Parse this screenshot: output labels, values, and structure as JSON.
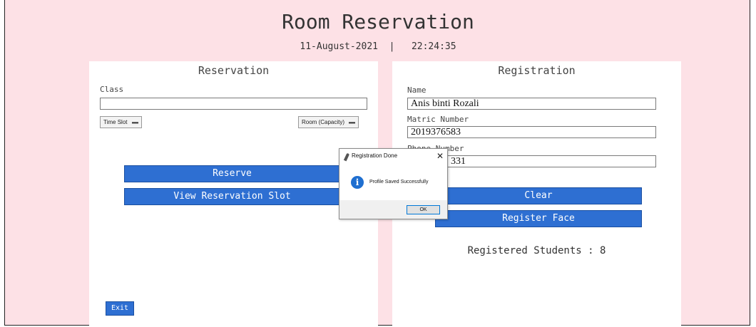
{
  "header": {
    "title": "Room Reservation",
    "date": "11-August-2021",
    "separator": "|",
    "time": "22:24:35"
  },
  "reservation": {
    "title": "Reservation",
    "class_label": "Class",
    "class_value": "",
    "time_slot": "Time Slot",
    "room_capacity": "Room (Capacity)",
    "reserve_button": "Reserve",
    "view_slot_button": "View Reservation Slot",
    "exit_button": "Exit"
  },
  "registration": {
    "title": "Registration",
    "name_label": "Name",
    "name_value": "Anis binti Rozali",
    "matric_label": "Matric Number",
    "matric_value": "2019376583",
    "phone_label": "Phone Number",
    "phone_value": "331",
    "clear_button": "Clear",
    "register_face_button": "Register Face",
    "registered_students": "Registered Students : 8"
  },
  "dialog": {
    "title": "Registration Done",
    "close": "✕",
    "info_glyph": "i",
    "message": "Profile Saved Successfully",
    "ok_button": "OK"
  },
  "colors": {
    "background": "#fde1e6",
    "panel": "#ffffff",
    "button": "#2e6fd2"
  },
  "icons": {
    "dialog_app": "feather-icon",
    "dialog_info": "info-icon",
    "dialog_close": "close-icon"
  }
}
